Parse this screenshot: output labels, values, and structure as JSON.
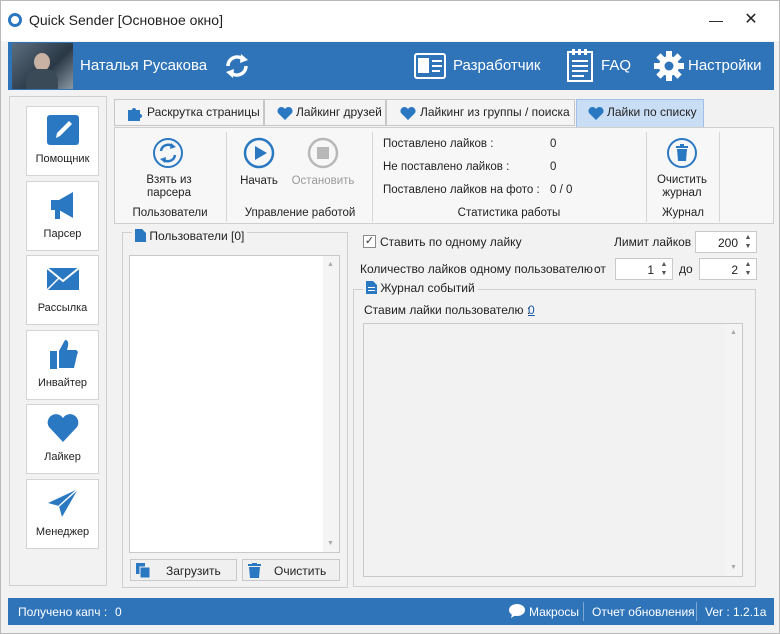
{
  "window": {
    "title": "Quick Sender [Основное окно]",
    "minimize": "—",
    "close": "✕"
  },
  "topbar": {
    "username": "Наталья Русакова",
    "developer_label": "Разработчик",
    "faq_label": "FAQ",
    "settings_label": "Настройки"
  },
  "sidebar": {
    "items": [
      {
        "label": "Помощник",
        "icon": "pencil-icon"
      },
      {
        "label": "Парсер",
        "icon": "megaphone-icon"
      },
      {
        "label": "Рассылка",
        "icon": "envelope-icon"
      },
      {
        "label": "Инвайтер",
        "icon": "thumbs-up-icon"
      },
      {
        "label": "Лайкер",
        "icon": "heart-icon"
      },
      {
        "label": "Менеджер",
        "icon": "paper-plane-icon"
      }
    ]
  },
  "tabs": [
    {
      "label": "Раскрутка страницы",
      "icon": "puzzle-icon"
    },
    {
      "label": "Лайкинг друзей",
      "icon": "heart-icon"
    },
    {
      "label": "Лайкинг из группы / поиска",
      "icon": "heart-icon"
    },
    {
      "label": "Лайки по списку",
      "icon": "heart-icon",
      "active": true
    }
  ],
  "ribbon": {
    "take_from_parser": "Взять из парсера",
    "start": "Начать",
    "stop": "Остановить",
    "clear_journal": "Очистить журнал",
    "groups": {
      "users": "Пользователи",
      "control": "Управление работой",
      "stats": "Статистика работы",
      "journal": "Журнал"
    },
    "stats": [
      {
        "label": "Поставлено лайков :",
        "value": "0"
      },
      {
        "label": "Не поставлено лайков :",
        "value": "0"
      },
      {
        "label": "Поставлено лайков на фото :",
        "value": "0 / 0"
      }
    ]
  },
  "users_panel": {
    "title": "Пользователи [0]",
    "load_button": "Загрузить",
    "clear_button": "Очистить"
  },
  "options": {
    "one_like": "Ставить по одному лайку",
    "one_like_checked": true,
    "like_limit_label": "Лимит лайков :",
    "like_limit": "200",
    "per_user_label": "Количество лайков одному пользователю :",
    "from_label": "от",
    "from_value": "1",
    "to_label": "до",
    "to_value": "2"
  },
  "journal": {
    "title": "Журнал событий",
    "liking_user_label": "Ставим лайки пользователю :",
    "liking_user_value": "0"
  },
  "statusbar": {
    "captcha_label": "Получено капч :",
    "captcha_value": "0",
    "macros": "Макросы",
    "update_report": "Отчет обновления",
    "version": "Ver : 1.2.1a"
  },
  "colors": {
    "accent": "#2f74b8",
    "active_tab": "#c9def5",
    "icon_blue": "#2b78c2"
  }
}
